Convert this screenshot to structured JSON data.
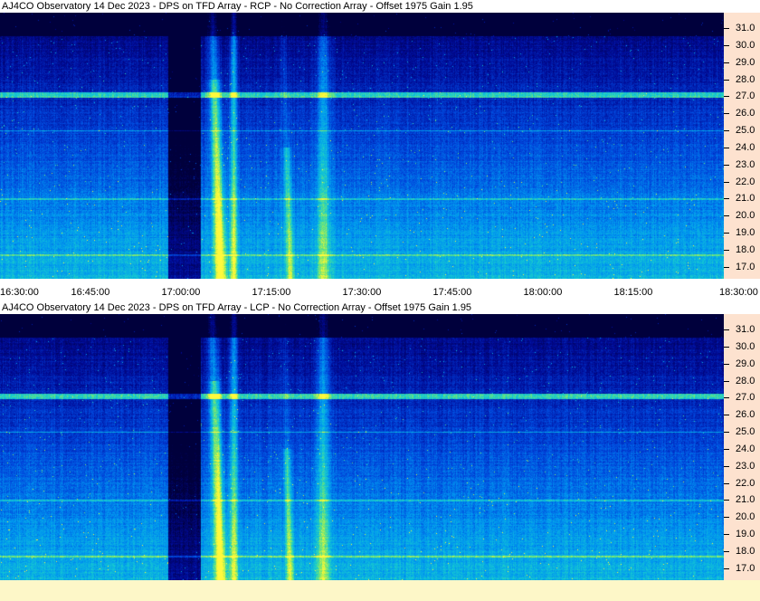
{
  "panels": [
    {
      "title": "AJ4CO Observatory 14 Dec 2023 - DPS on TFD Array  - RCP  -  No Correction Array  -  Offset 1975  Gain 1.95"
    },
    {
      "title": "AJ4CO Observatory 14 Dec 2023 - DPS on TFD Array  - LCP  -  No Correction Array  -  Offset 1975  Gain 1.95"
    }
  ],
  "chart_data": {
    "type": "heatmap",
    "x": [
      "16:30:00",
      "16:45:00",
      "17:00:00",
      "17:15:00",
      "17:30:00",
      "17:45:00",
      "18:00:00",
      "18:15:00",
      "18:30:00"
    ],
    "y_ticks": [
      "17.0",
      "18.0",
      "19.0",
      "20.0",
      "21.0",
      "22.0",
      "23.0",
      "24.0",
      "25.0",
      "26.0",
      "27.0",
      "28.0",
      "29.0",
      "30.0",
      "31.0"
    ],
    "ylim": [
      16.3,
      31.9
    ],
    "colors": {
      "low": "#00004a",
      "mid": "#1e90ff",
      "high": "#ffff40",
      "hot": "#ff60a0"
    }
  }
}
